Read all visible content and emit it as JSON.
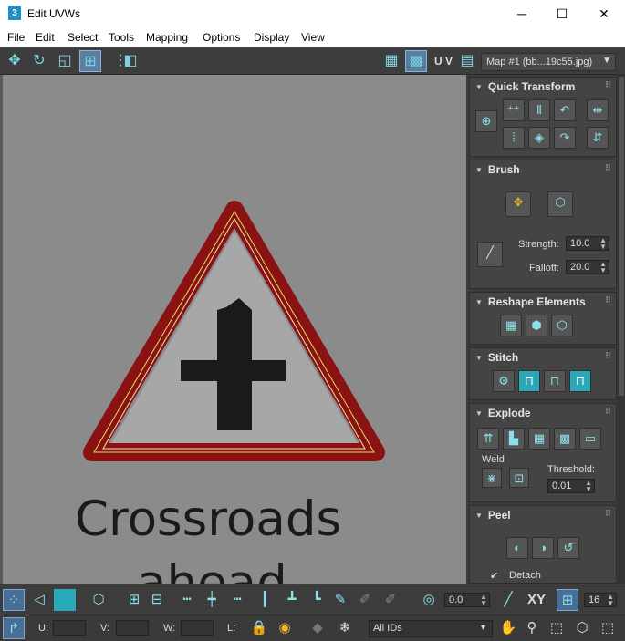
{
  "window": {
    "app_icon": "3",
    "title": "Edit UVWs",
    "min_glyph": "─",
    "max_glyph": "☐",
    "close_glyph": "✕"
  },
  "menu": [
    "File",
    "Edit",
    "Select",
    "Tools",
    "Mapping",
    "Options",
    "Display",
    "View"
  ],
  "toolbar": {
    "uv_label": "U V",
    "map_select_value": "Map #1 (bb...19c55.jpg)"
  },
  "viewport": {
    "texture_text": "Crossroads",
    "texture_text_2": "ahead",
    "colors": {
      "background": "#8b8b8b",
      "sign_border": "#8a1212",
      "sign_inner": "#a7a7a7",
      "uv_edges": "#e0e060"
    }
  },
  "panel": {
    "quick_transform": {
      "title": "Quick Transform"
    },
    "brush": {
      "title": "Brush",
      "strength_label": "Strength:",
      "strength_value": "10.0",
      "falloff_label": "Falloff:",
      "falloff_value": "20.0"
    },
    "reshape": {
      "title": "Reshape Elements"
    },
    "stitch": {
      "title": "Stitch"
    },
    "explode": {
      "title": "Explode",
      "weld_label": "Weld",
      "threshold_label": "Threshold:",
      "threshold_value": "0.01"
    },
    "peel": {
      "title": "Peel",
      "detach_label": "Detach",
      "detach_checked": true
    }
  },
  "bottom_toolbar": {
    "rotation_value": "0.0",
    "xy_label": "XY",
    "grid_value": "16"
  },
  "status": {
    "u_label": "U:",
    "v_label": "V:",
    "w_label": "W:",
    "l_label": "L:",
    "ids_select_value": "All IDs"
  }
}
